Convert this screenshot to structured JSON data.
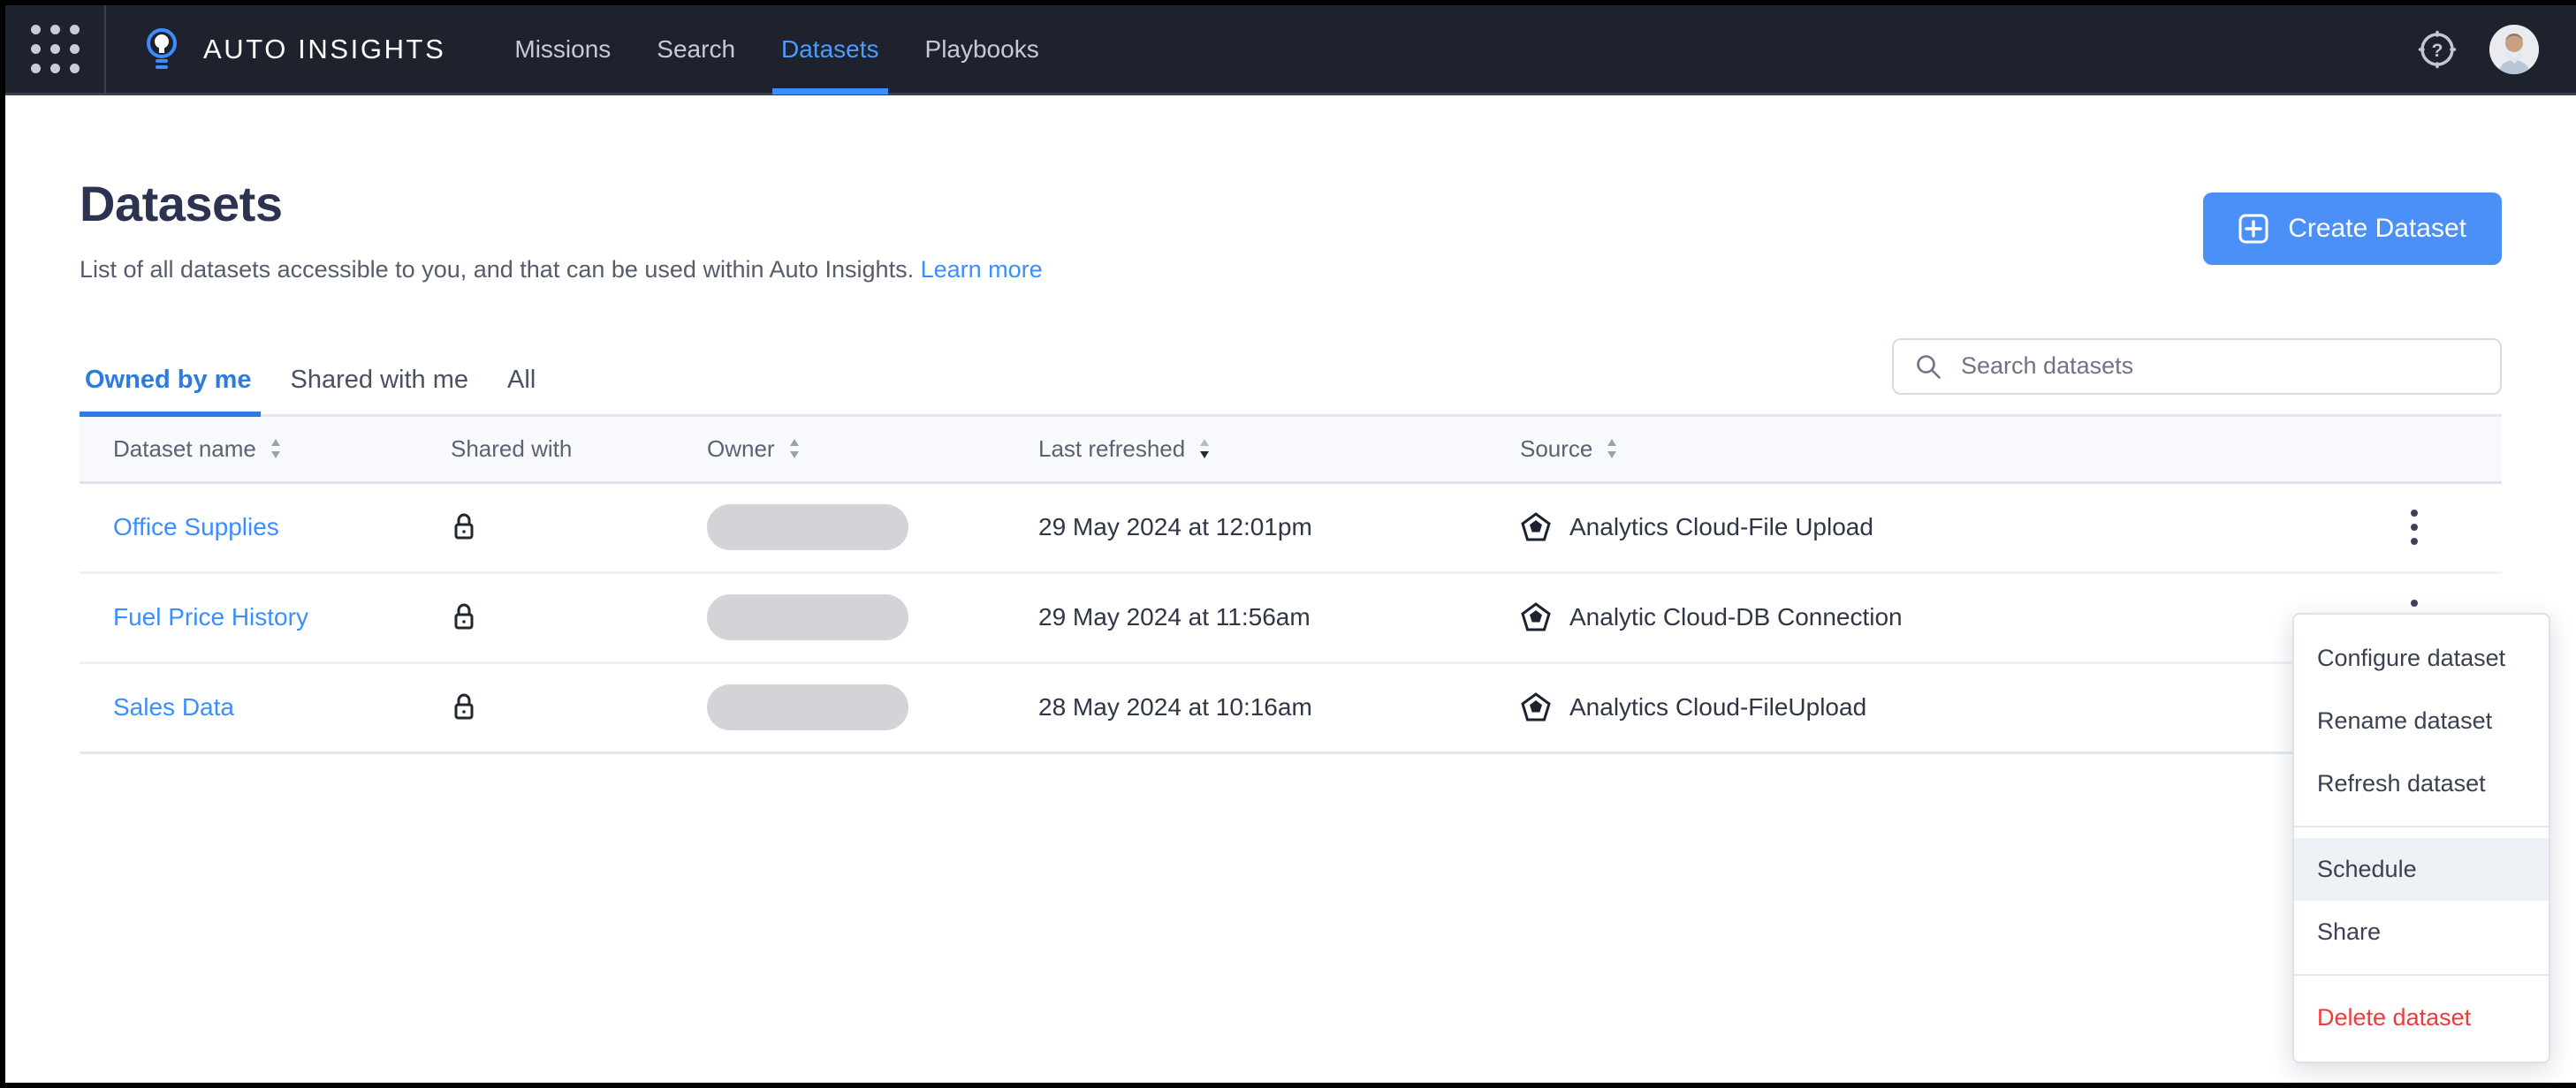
{
  "topbar": {
    "app_grid_icon": "app-grid-icon",
    "logo_icon": "lightbulb-icon",
    "brand": "AUTO INSIGHTS",
    "nav": [
      {
        "label": "Missions",
        "active": false
      },
      {
        "label": "Search",
        "active": false
      },
      {
        "label": "Datasets",
        "active": true
      },
      {
        "label": "Playbooks",
        "active": false
      }
    ],
    "help_icon": "help-circle-icon",
    "avatar_icon": "user-avatar"
  },
  "page": {
    "title": "Datasets",
    "subtitle_text": "List of all datasets accessible to you, and that can be used within Auto Insights.",
    "learn_more": "Learn more",
    "create_button": "Create Dataset",
    "create_button_icon": "plus-square-icon",
    "accent_color": "#4a90f7"
  },
  "tabs": [
    {
      "label": "Owned by me",
      "active": true
    },
    {
      "label": "Shared with me",
      "active": false
    },
    {
      "label": "All",
      "active": false
    }
  ],
  "search": {
    "placeholder": "Search datasets",
    "value": "",
    "icon": "search-icon"
  },
  "table": {
    "columns": [
      {
        "label": "Dataset name",
        "sortable": true,
        "sort_state": "none"
      },
      {
        "label": "Shared with",
        "sortable": false,
        "sort_state": "none"
      },
      {
        "label": "Owner",
        "sortable": true,
        "sort_state": "none"
      },
      {
        "label": "Last refreshed",
        "sortable": true,
        "sort_state": "desc"
      },
      {
        "label": "Source",
        "sortable": true,
        "sort_state": "none"
      }
    ],
    "rows": [
      {
        "name": "Office Supplies",
        "shared_with_icon": "lock-icon",
        "owner": "",
        "last_refreshed": "29 May 2024 at 12:01pm",
        "source": "Analytics Cloud-File Upload",
        "source_icon": "analytics-cloud-icon"
      },
      {
        "name": "Fuel Price History",
        "shared_with_icon": "lock-icon",
        "owner": "",
        "last_refreshed": "29 May 2024 at 11:56am",
        "source": "Analytic Cloud-DB Connection",
        "source_icon": "analytics-cloud-icon"
      },
      {
        "name": "Sales Data",
        "shared_with_icon": "lock-icon",
        "owner": "",
        "last_refreshed": "28 May 2024 at 10:16am",
        "source": "Analytics Cloud-FileUpload",
        "source_icon": "analytics-cloud-icon"
      }
    ]
  },
  "context_menu": {
    "open": true,
    "items": [
      {
        "label": "Configure dataset",
        "hover": false,
        "danger": false
      },
      {
        "label": "Rename dataset",
        "hover": false,
        "danger": false
      },
      {
        "label": "Refresh dataset",
        "hover": false,
        "danger": false
      },
      {
        "label": "Schedule",
        "hover": true,
        "danger": false
      },
      {
        "label": "Share",
        "hover": false,
        "danger": false
      },
      {
        "label": "Delete dataset",
        "hover": false,
        "danger": true
      }
    ],
    "danger_color": "#ef3b3b"
  }
}
